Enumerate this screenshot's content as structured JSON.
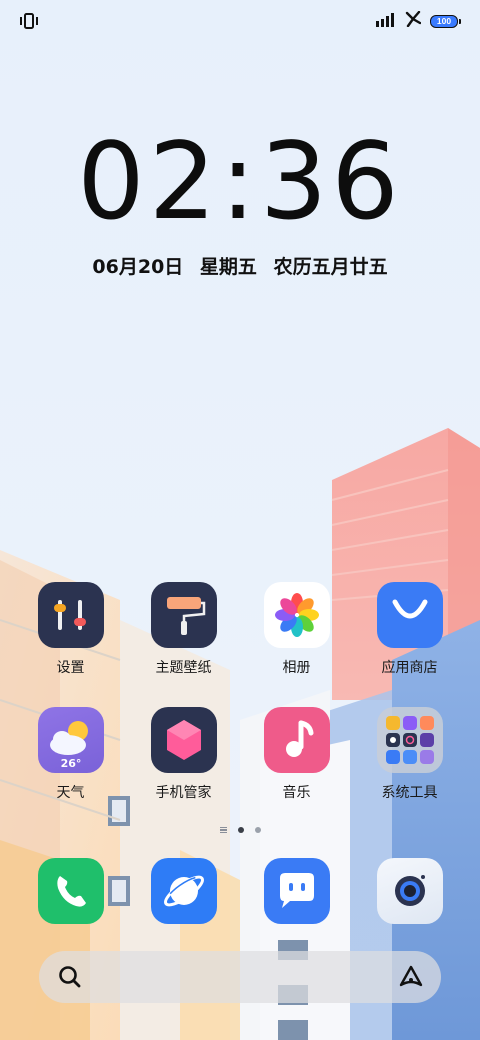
{
  "status_bar": {
    "left_icon": "vibrate-icon",
    "right_icons": [
      "signal-icon",
      "no-service-icon"
    ],
    "battery": "100"
  },
  "lockscreen": {
    "time": "02:36",
    "date": "06月20日",
    "weekday": "星期五",
    "lunar": "农历五月廿五"
  },
  "apps": [
    {
      "id": "settings",
      "label": "设置",
      "icon": "settings-sliders-icon"
    },
    {
      "id": "themes",
      "label": "主题壁纸",
      "icon": "paint-roller-icon"
    },
    {
      "id": "gallery",
      "label": "相册",
      "icon": "flower-icon"
    },
    {
      "id": "appstore",
      "label": "应用商店",
      "icon": "shopping-bag-icon"
    },
    {
      "id": "weather",
      "label": "天气",
      "icon": "weather-cloud-sun-icon",
      "badge": "26°"
    },
    {
      "id": "phone-manager",
      "label": "手机管家",
      "icon": "shield-hexagon-icon"
    },
    {
      "id": "music",
      "label": "音乐",
      "icon": "music-note-icon"
    },
    {
      "id": "system-tools",
      "label": "系统工具",
      "icon": "folder-icon"
    }
  ],
  "pages": {
    "count": 2,
    "active": 1
  },
  "dock": [
    {
      "id": "dialer",
      "icon": "phone-icon"
    },
    {
      "id": "browser",
      "icon": "planet-icon"
    },
    {
      "id": "messages",
      "icon": "chat-bubble-icon"
    },
    {
      "id": "camera",
      "icon": "camera-icon"
    }
  ],
  "search": {
    "placeholder": "",
    "left_icon": "search-icon",
    "right_icon": "assistant-icon"
  },
  "colors": {
    "sky": "#e9f1fb",
    "settings_bg": "#2b3350",
    "appstore_bg": "#3a7bf5",
    "weather_bg": "#8a6fe0",
    "music_bg": "#ef5b8a",
    "dialer_bg": "#1fbf6b",
    "browser_bg": "#2e7cf6",
    "messages_bg": "#3a7bf5",
    "battery_fill": "#3a7bff"
  }
}
